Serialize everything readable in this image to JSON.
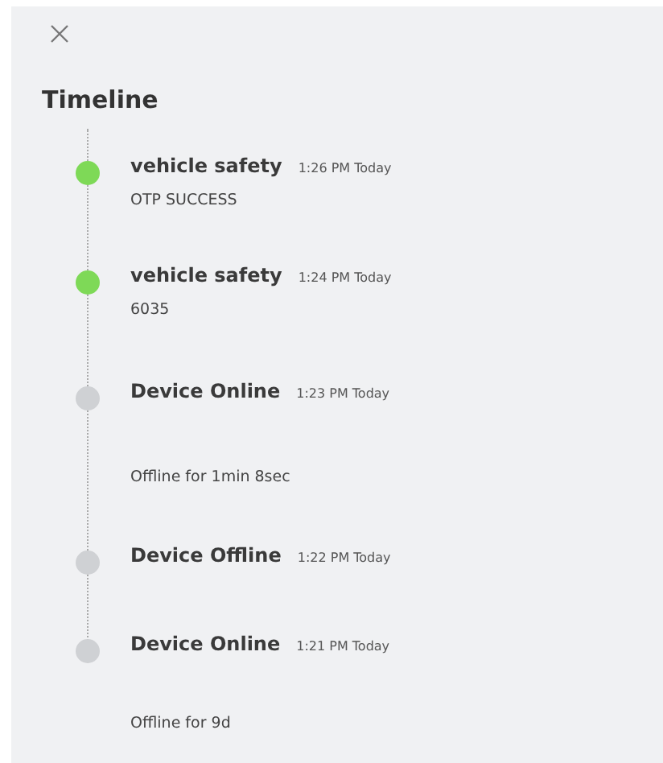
{
  "title": "Timeline",
  "events": [
    {
      "title": "vehicle safety",
      "time": "1:26 PM Today",
      "detail": "OTP SUCCESS",
      "color": "#7ed957"
    },
    {
      "title": "vehicle safety",
      "time": "1:24 PM Today",
      "detail": "6035",
      "color": "#7ed957"
    },
    {
      "title": "Device Online",
      "time": "1:23 PM Today",
      "detail": "Offline for 1min 8sec",
      "color": "#cfd1d4"
    },
    {
      "title": "Device Offline",
      "time": "1:22 PM Today",
      "color": "#cfd1d4"
    },
    {
      "title": "Device Online",
      "time": "1:21 PM Today",
      "detail": "Offline for 9d",
      "color": "#cfd1d4"
    }
  ]
}
